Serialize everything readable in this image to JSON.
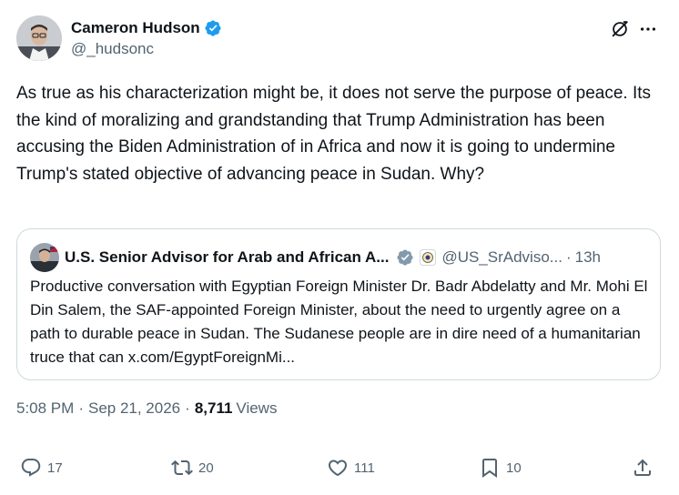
{
  "author": {
    "name": "Cameron Hudson",
    "handle": "@_hudsonc"
  },
  "tweet": {
    "text": "As true as his characterization might be, it does not serve the purpose of peace. Its the kind of moralizing and grandstanding that Trump Administration has been accusing the Biden Administration of in Africa and now it is going to undermine Trump's stated objective of advancing peace in Sudan. Why?"
  },
  "quote": {
    "name": "U.S. Senior Advisor for Arab and African A...",
    "handle": "@US_SrAdviso...",
    "dot": "·",
    "time": "13h",
    "text": "Productive conversation with Egyptian Foreign Minister Dr. Badr Abdelatty and Mr. Mohi El Din Salem, the SAF-appointed Foreign Minister, about the need to urgently agree on a path to durable peace in Sudan. The Sudanese people are in dire need of a humanitarian truce that can x.com/EgyptForeignMi..."
  },
  "meta": {
    "time": "5:08 PM",
    "date": "Sep 21, 2026",
    "views_count": "8,711",
    "views_label": "Views",
    "separator": "·"
  },
  "actions": {
    "replies": "17",
    "reposts": "20",
    "likes": "111",
    "bookmarks": "10"
  },
  "colors": {
    "verified": "#1d9bf0",
    "secondary_text": "#536471",
    "primary_text": "#0f1419",
    "border": "#cfd9de"
  },
  "icons": [
    "verified-badge-icon",
    "grok-icon",
    "more-icon",
    "reply-icon",
    "repost-icon",
    "like-icon",
    "bookmark-icon",
    "share-icon"
  ]
}
